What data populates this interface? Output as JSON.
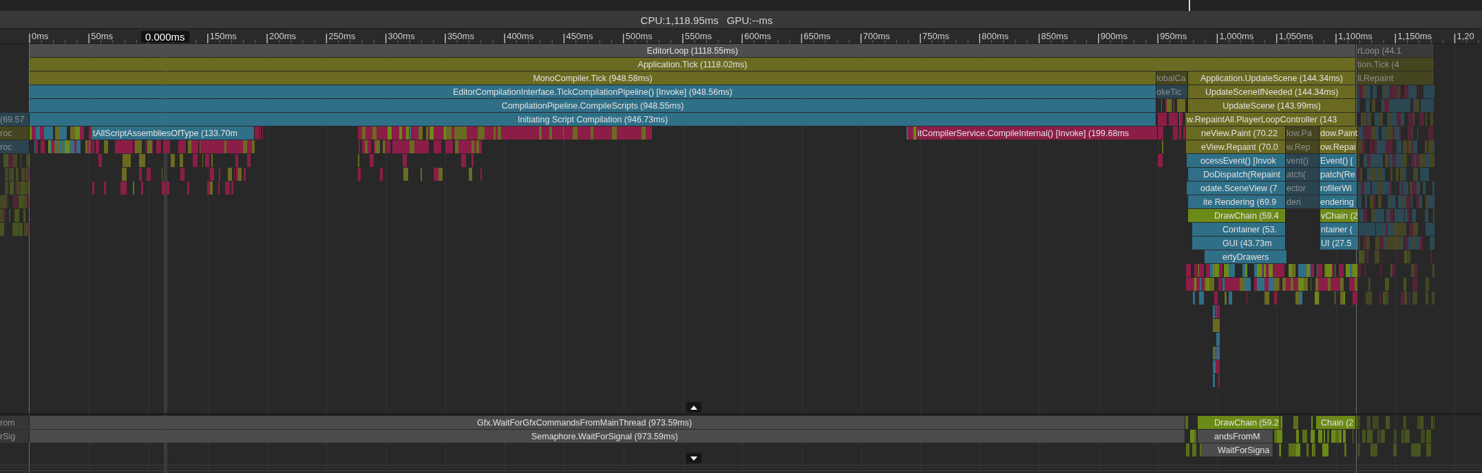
{
  "stats": {
    "cpu": "CPU:1,118.95ms",
    "gpu": "GPU:--ms"
  },
  "ruler": {
    "cursor": "0.000ms",
    "ticks": [
      "0ms",
      "50ms",
      "150ms",
      "200ms",
      "250ms",
      "300ms",
      "350ms",
      "400ms",
      "450ms",
      "500ms",
      "550ms",
      "600ms",
      "650ms",
      "700ms",
      "750ms",
      "800ms",
      "850ms",
      "900ms",
      "950ms",
      "1,000ms",
      "1,050ms",
      "1,100ms",
      "1,150ms",
      "1,20"
    ]
  },
  "main_thread": {
    "bars": [
      {
        "label": "EditorLoop (1118.55ms)",
        "color": "#4e4e4e",
        "dimmed": false
      },
      {
        "label": "Application.Tick (1118.02ms)",
        "color": "#6a6a22",
        "dimmed": false
      },
      {
        "label": "MonoCompiler.Tick (948.58ms)",
        "color": "#6a6a22",
        "dimmed": false
      },
      {
        "label": "lobalCa",
        "color": "#45451f",
        "dimmed": true
      },
      {
        "label": "Application.UpdateScene (144.34ms)",
        "color": "#6a6a22",
        "dimmed": false
      },
      {
        "label": "EditorCompilationInterface.TickCompilationPipeline() [Invoke] (948.56ms)",
        "color": "#2f6f88",
        "dimmed": false
      },
      {
        "label": "okeTic",
        "color": "#2b4450",
        "dimmed": true
      },
      {
        "label": "UpdateSceneIfNeeded (144.34ms)",
        "color": "#6a6a22",
        "dimmed": false
      },
      {
        "label": "CompilationPipeline.CompileScripts (948.55ms)",
        "color": "#2f6f88",
        "dimmed": false
      },
      {
        "label": "UpdateScene (143.99ms)",
        "color": "#6a6a22",
        "dimmed": false
      },
      {
        "label": "Initiating Script Compilation (946.73ms)",
        "color": "#2f6f88",
        "dimmed": false
      },
      {
        "label": "w.RepaintAll.PlayerLoopController (143",
        "color": "#6a6a22",
        "dimmed": false
      },
      {
        "label": "tAllScriptAssembliesOfType (133.70m",
        "color": "#2f6f88",
        "dimmed": false
      },
      {
        "label": "itCompilerService.CompileInternal() [Invoke] (199.68ms",
        "color": "#8c1d47",
        "dimmed": false
      },
      {
        "label": "neView.Paint (70.22",
        "color": "#6a6a22",
        "dimmed": false
      },
      {
        "label": "low.Pa",
        "color": "#45451f",
        "dimmed": true
      },
      {
        "label": "dow.Paint",
        "color": "#6a6a22",
        "dimmed": false
      },
      {
        "label": "eView.Repaint (70.0",
        "color": "#6a6a22",
        "dimmed": false
      },
      {
        "label": "w.Rep",
        "color": "#45451f",
        "dimmed": true
      },
      {
        "label": "ow.Repai",
        "color": "#6a6a22",
        "dimmed": false
      },
      {
        "label": "ocessEvent() [Invok",
        "color": "#2f6f88",
        "dimmed": false
      },
      {
        "label": "vent()",
        "color": "#2b4450",
        "dimmed": true
      },
      {
        "label": "Event() [",
        "color": "#2f6f88",
        "dimmed": false
      },
      {
        "label": "DoDispatch(Repaint",
        "color": "#2f6f88",
        "dimmed": false
      },
      {
        "label": "atch(",
        "color": "#2b4450",
        "dimmed": true
      },
      {
        "label": "patch(Re",
        "color": "#2f6f88",
        "dimmed": false
      },
      {
        "label": "odate.SceneView (7",
        "color": "#2f6f88",
        "dimmed": false
      },
      {
        "label": "ector",
        "color": "#2b4450",
        "dimmed": true
      },
      {
        "label": "rofilerWi",
        "color": "#2f6f88",
        "dimmed": false
      },
      {
        "label": "ite Rendering (69.9",
        "color": "#2f6f88",
        "dimmed": false
      },
      {
        "label": "deri",
        "color": "#2b4450",
        "dimmed": true
      },
      {
        "label": "endering",
        "color": "#2f6f88",
        "dimmed": false
      },
      {
        "label": "DrawChain (59.4",
        "color": "#6b8a17",
        "dimmed": false
      },
      {
        "label": "vChain (2",
        "color": "#6b8a17",
        "dimmed": false
      },
      {
        "label": "Container (53.",
        "color": "#2f6f88",
        "dimmed": false
      },
      {
        "label": "ntainer (",
        "color": "#2f6f88",
        "dimmed": false
      },
      {
        "label": "GUI (43.73m",
        "color": "#2f6f88",
        "dimmed": false
      },
      {
        "label": "UI (27.5",
        "color": "#2f6f88",
        "dimmed": false
      },
      {
        "label": "ertyDrawers",
        "color": "#2f6f88",
        "dimmed": false
      },
      {
        "label": "(69.57",
        "color": "#2b4450",
        "dimmed": true
      },
      {
        "label": "roc",
        "color": "#45451f",
        "dimmed": true
      },
      {
        "label": "roc",
        "color": "#2b4450",
        "dimmed": true
      },
      {
        "label": "rLoop (44.1",
        "color": "#3a3a3a",
        "dimmed": true
      },
      {
        "label": "tion.Tick (4",
        "color": "#45451f",
        "dimmed": true
      },
      {
        "label": "ll.Repaint",
        "color": "#45451f",
        "dimmed": true
      }
    ]
  },
  "render_thread": {
    "bars": [
      {
        "label": "rom",
        "color": "#363636",
        "dimmed": true
      },
      {
        "label": "Gfx.WaitForGfxCommandsFromMainThread (973.59ms)",
        "color": "#4b4b4b",
        "dimmed": false
      },
      {
        "label": "rSig",
        "color": "#363636",
        "dimmed": true
      },
      {
        "label": "Semaphore.WaitForSignal (973.59ms)",
        "color": "#4b4b4b",
        "dimmed": false
      },
      {
        "label": "DrawChain (59.2",
        "color": "#6b8a17",
        "dimmed": false
      },
      {
        "label": "Chain (2",
        "color": "#6b8a17",
        "dimmed": false
      },
      {
        "label": "andsFromM",
        "color": "#4b4b4b",
        "dimmed": false
      },
      {
        "label": "WaitForSigna",
        "color": "#4b4b4b",
        "dimmed": false
      }
    ]
  }
}
